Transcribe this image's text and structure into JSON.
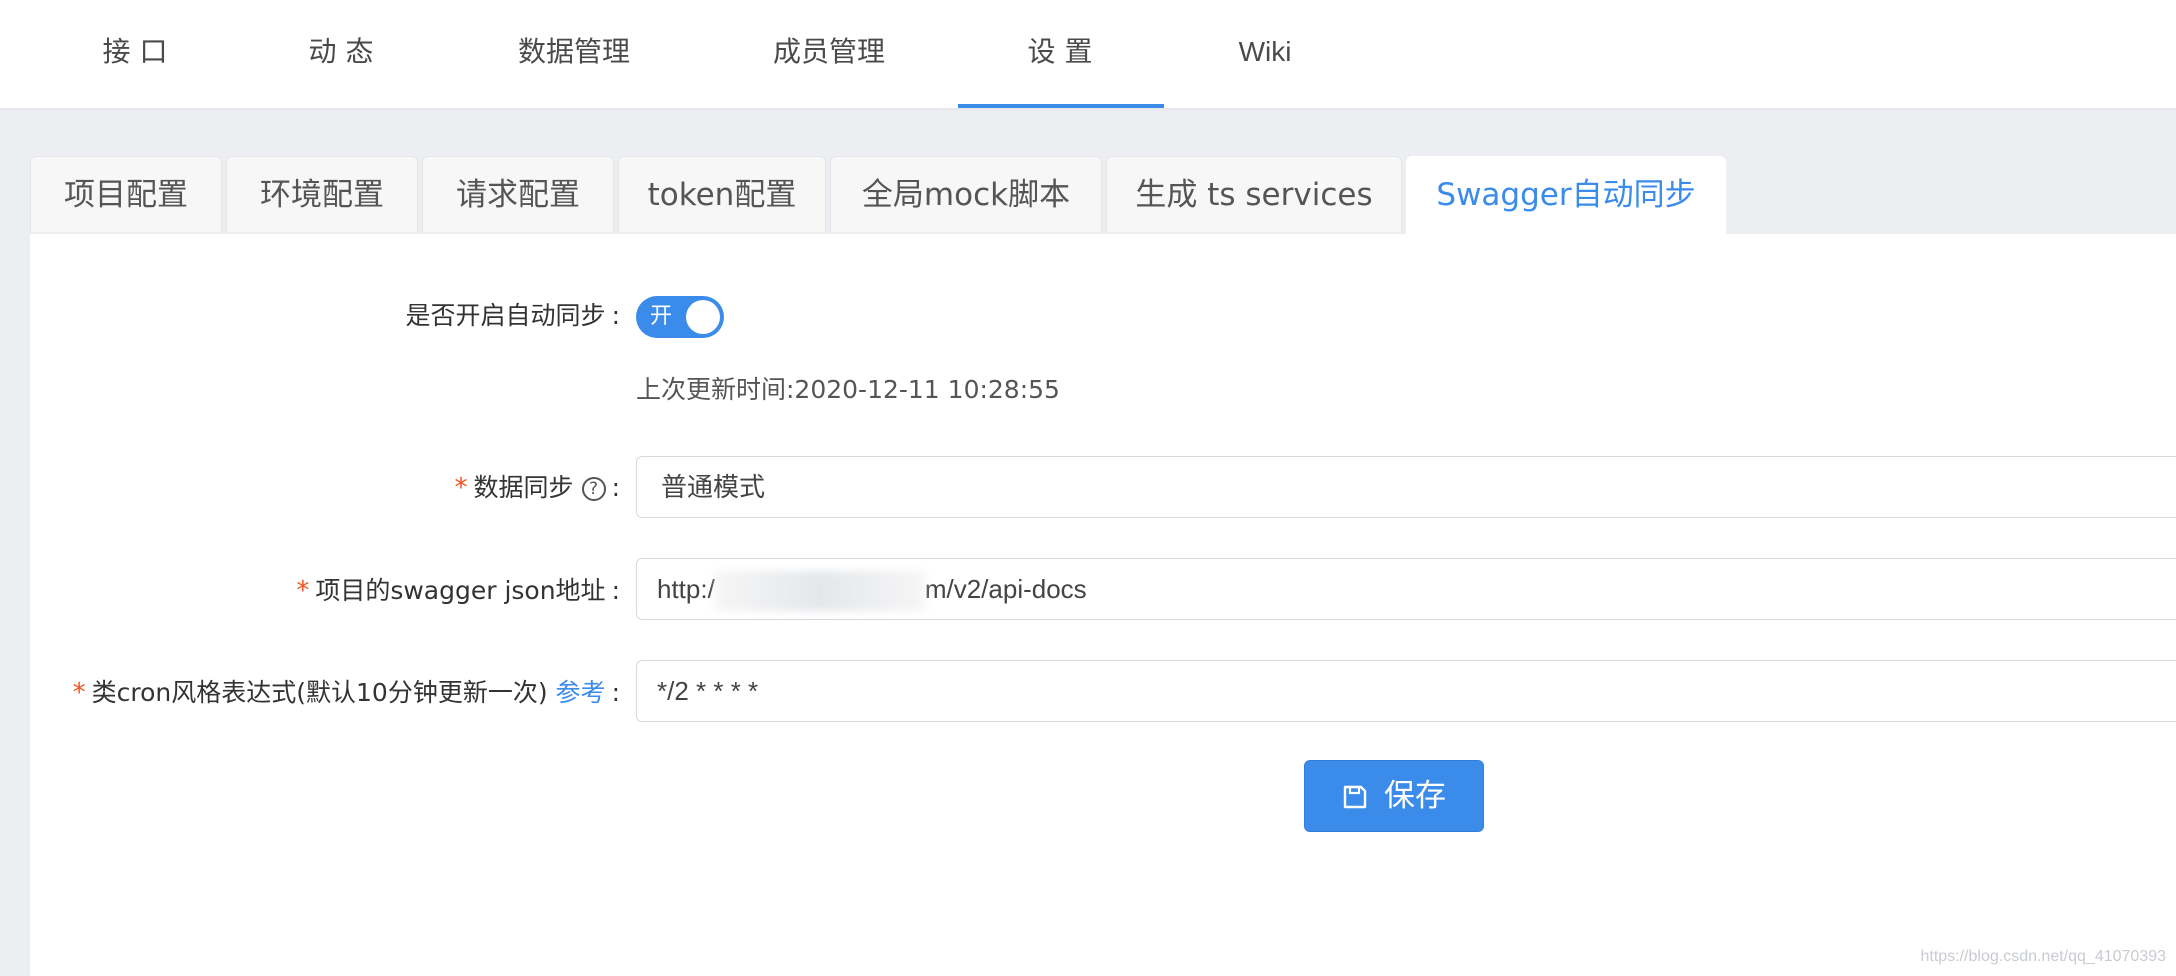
{
  "topnav": {
    "items": [
      {
        "label": "接 口"
      },
      {
        "label": "动 态"
      },
      {
        "label": "数据管理"
      },
      {
        "label": "成员管理"
      },
      {
        "label": "设 置",
        "active": true
      },
      {
        "label": "Wiki"
      }
    ]
  },
  "tabs": [
    {
      "label": "项目配置"
    },
    {
      "label": "环境配置"
    },
    {
      "label": "请求配置"
    },
    {
      "label": "token配置"
    },
    {
      "label": "全局mock脚本"
    },
    {
      "label": "生成 ts services"
    },
    {
      "label": "Swagger自动同步",
      "active": true
    }
  ],
  "form": {
    "auto_sync": {
      "label": "是否开启自动同步",
      "switch_text": "开",
      "enabled": true
    },
    "last_update": "上次更新时间:2020-12-11 10:28:55",
    "data_sync": {
      "label": "数据同步",
      "help_icon": "question-circle-icon",
      "value": "普通模式"
    },
    "swagger_url": {
      "label": "项目的swagger json地址",
      "value_prefix": "http:/",
      "value_suffix": "m/v2/api-docs"
    },
    "cron": {
      "label": "类cron风格表达式(默认10分钟更新一次)",
      "link": "参考",
      "value": "*/2 * * * *"
    },
    "colon": ":",
    "required_mark": "*"
  },
  "save_button": {
    "label": "保存",
    "icon": "save-icon"
  },
  "watermark": "https://blog.csdn.net/qq_41070393",
  "colors": {
    "accent": "#3b8bea",
    "required": "#f4511e",
    "background": "#eceef2"
  }
}
